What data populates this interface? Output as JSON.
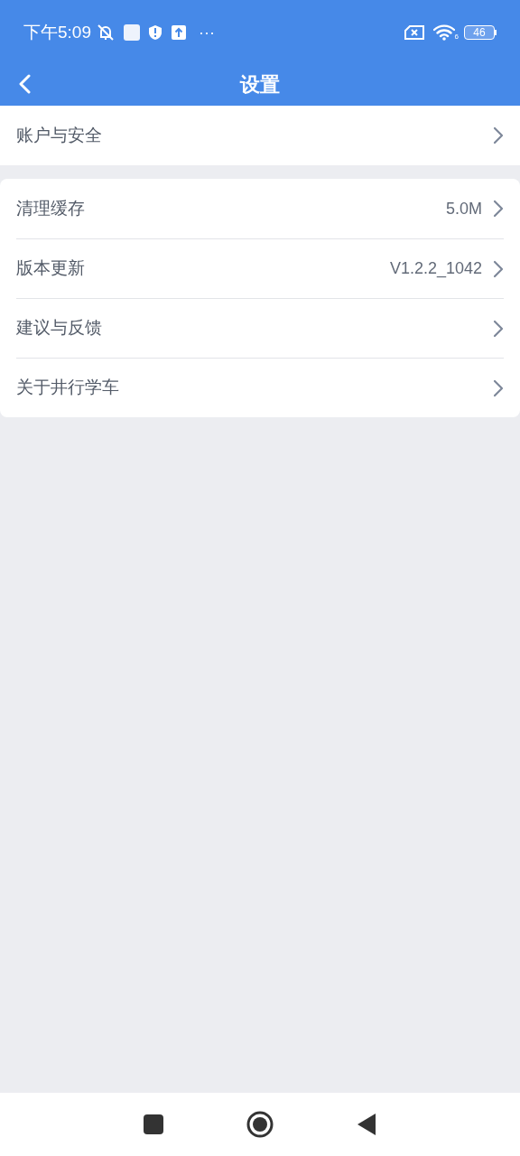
{
  "status_bar": {
    "time": "下午5:09",
    "more": "···",
    "wifi_generation": "6",
    "battery": "46"
  },
  "header": {
    "title": "设置"
  },
  "sections": [
    {
      "items": [
        {
          "label": "账户与安全"
        }
      ]
    },
    {
      "items": [
        {
          "label": "清理缓存",
          "value": "5.0M"
        },
        {
          "label": "版本更新",
          "value": "V1.2.2_1042"
        },
        {
          "label": "建议与反馈"
        },
        {
          "label": "关于井行学车"
        }
      ]
    }
  ]
}
